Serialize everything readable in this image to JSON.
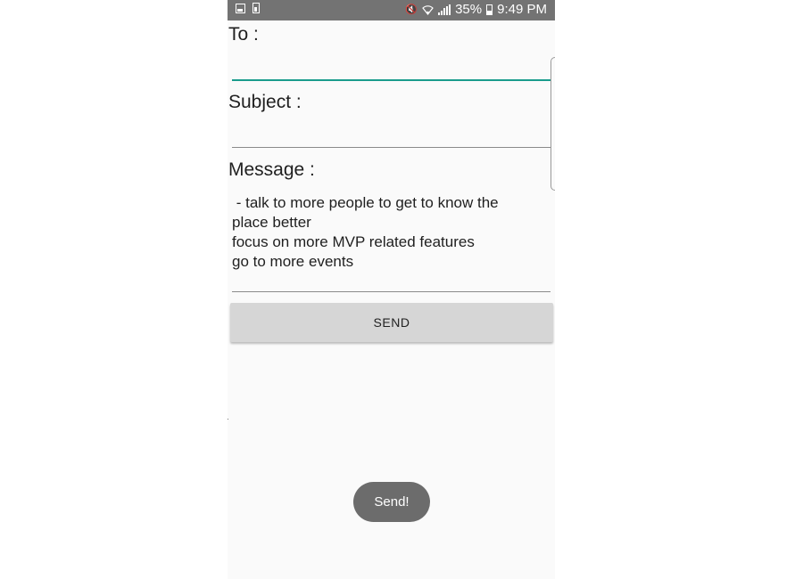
{
  "status_bar": {
    "battery_percent": "35%",
    "time": "9:49 PM",
    "icons": [
      "gallery-icon",
      "battery-saver-icon",
      "mute-icon",
      "wifi-icon",
      "signal-icon",
      "battery-icon"
    ]
  },
  "form": {
    "to_label": "To :",
    "to_value": "",
    "subject_label": "Subject :",
    "subject_value": "",
    "message_label": "Message :",
    "message_value": " - talk to more people to get to know the\nplace better\nfocus on more MVP related features\ngo to more events"
  },
  "send_button": {
    "label": "SEND"
  },
  "toast": {
    "text": "Send!"
  },
  "colors": {
    "status_bar_bg": "#737373",
    "focus_underline": "#1a9c8c",
    "button_bg": "#d6d6d6",
    "toast_bg": "#6c6c6c"
  }
}
